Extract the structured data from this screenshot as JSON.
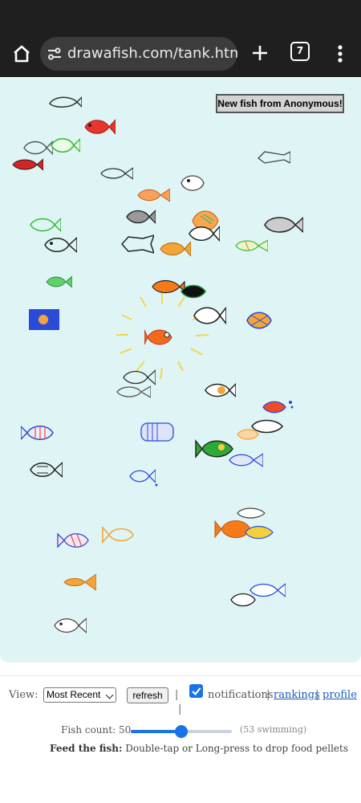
{
  "browser": {
    "url": "drawafish.com/tank.html?c",
    "tab_count": "7"
  },
  "tank": {
    "new_fish_label": "New fish from Anonymous!"
  },
  "controls": {
    "view_label": "View:",
    "view_selected": "Most Recent",
    "refresh_label": "refresh",
    "separator": "|",
    "notifications_label": "notifications",
    "notifications_checked": true,
    "rankings_label": "rankings",
    "profile_label": "profile",
    "fish_count_label": "Fish count: 50",
    "fish_count_value": 50,
    "swimming_label": "(53 swimming)",
    "feed_title": "Feed the fish:",
    "feed_text": "Double-tap or Long-press to drop food pellets"
  },
  "colors": {
    "tank_bg": "#dff5f5",
    "chrome_bg": "#1f1f1f",
    "accent": "#1a73e8",
    "link": "#1a5cb8"
  },
  "icons": [
    "home-icon",
    "site-settings-icon",
    "new-tab-icon",
    "tab-switcher-icon",
    "more-menu-icon",
    "checkbox-icon",
    "fish-icon"
  ]
}
